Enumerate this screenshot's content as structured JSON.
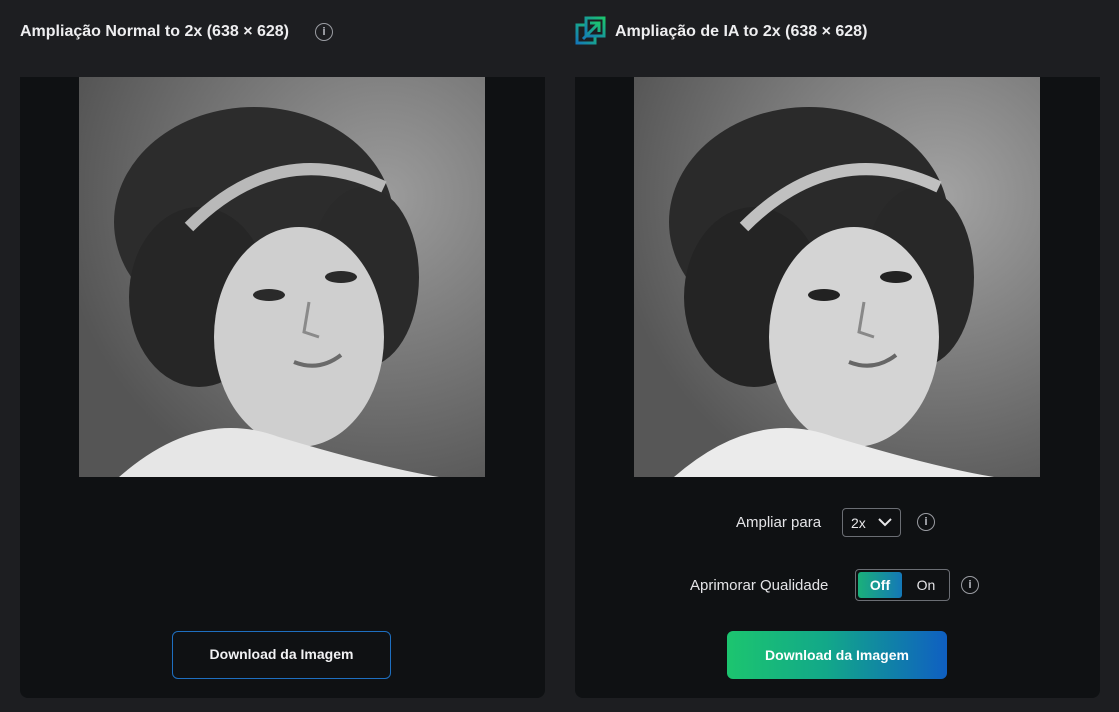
{
  "left_panel": {
    "title": "Ampliação Normal to 2x (638 × 628)",
    "info_icon": "info-icon",
    "download_label": "Download da Imagem"
  },
  "right_panel": {
    "title": "Ampliação de IA to 2x (638 × 628)",
    "brand_icon": "ai-upscale-icon",
    "scale_label": "Ampliar para",
    "scale_value": "2x",
    "quality_label": "Aprimorar Qualidade",
    "quality_off": "Off",
    "quality_on": "On",
    "quality_state": "Off",
    "download_label": "Download da Imagem"
  },
  "colors": {
    "background": "#1d1e21",
    "panel": "#0f1113",
    "accent_green": "#1cc56f",
    "accent_blue": "#0f5fc2",
    "outline_blue": "#1e6fc0"
  }
}
